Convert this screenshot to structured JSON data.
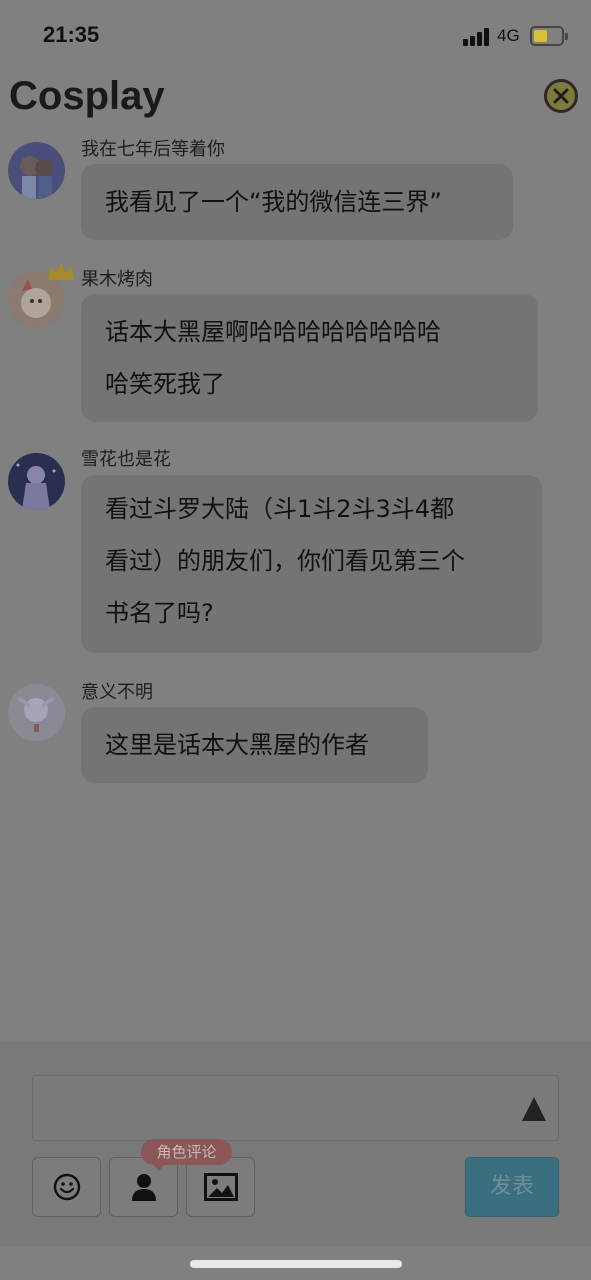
{
  "status_bar": {
    "time": "21:35",
    "network": "4G",
    "battery_level": 0.45,
    "battery_color": "#d9c13a"
  },
  "header": {
    "title": "Cosplay",
    "close_icon": "close-circle-icon"
  },
  "messages": [
    {
      "username": "我在七年后等着你",
      "lines": [
        "我看见了一个“我的微信连三界”"
      ]
    },
    {
      "username": "果木烤肉",
      "lines": [
        "话本大黑屋啊哈哈哈哈哈哈哈哈",
        "哈笑死我了"
      ]
    },
    {
      "username": "雪花也是花",
      "lines": [
        "看过斗罗大陆（斗1斗2斗3斗4都",
        "看过）的朋友们，你们看见第三个",
        "书名了吗?"
      ]
    },
    {
      "username": "意义不明",
      "lines": [
        "这里是话本大黑屋的作者"
      ]
    }
  ],
  "composer": {
    "input_value": "",
    "expand_icon": "triangle-up-icon",
    "emoji_icon": "smiley-icon",
    "role_icon": "person-icon",
    "image_icon": "image-icon",
    "role_badge": "角色评论",
    "send_label": "发表"
  },
  "colors": {
    "send_button": "#3a6f7f",
    "role_badge": "#8a5656",
    "overlay": "#808080"
  }
}
